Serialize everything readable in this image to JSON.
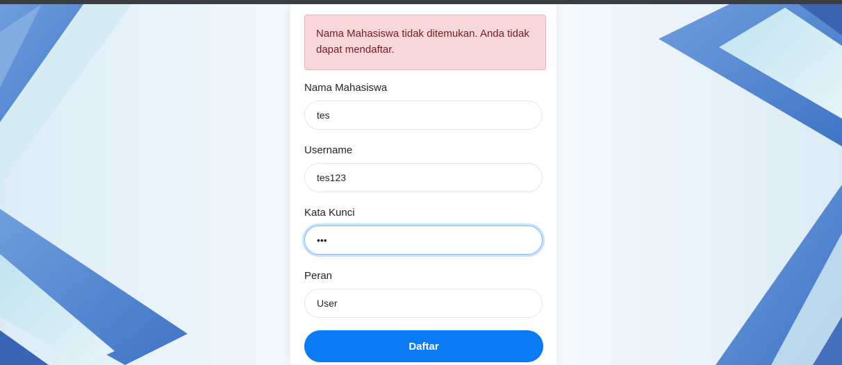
{
  "alert": {
    "message": "Nama Mahasiswa tidak ditemukan. Anda tidak dapat mendaftar."
  },
  "form": {
    "fields": [
      {
        "label": "Nama Mahasiswa",
        "value": "tes",
        "type": "text"
      },
      {
        "label": "Username",
        "value": "tes123",
        "type": "text"
      },
      {
        "label": "Kata Kunci",
        "value": "tes",
        "type": "password",
        "focused": true
      },
      {
        "label": "Peran",
        "value": "User",
        "type": "select"
      }
    ],
    "submit_label": "Daftar"
  },
  "colors": {
    "primary": "#0b7bf3",
    "alert_bg": "#f8d7da",
    "alert_text": "#721c24",
    "background": "#eef6fb",
    "accent_blue": "#5b8fd6"
  }
}
